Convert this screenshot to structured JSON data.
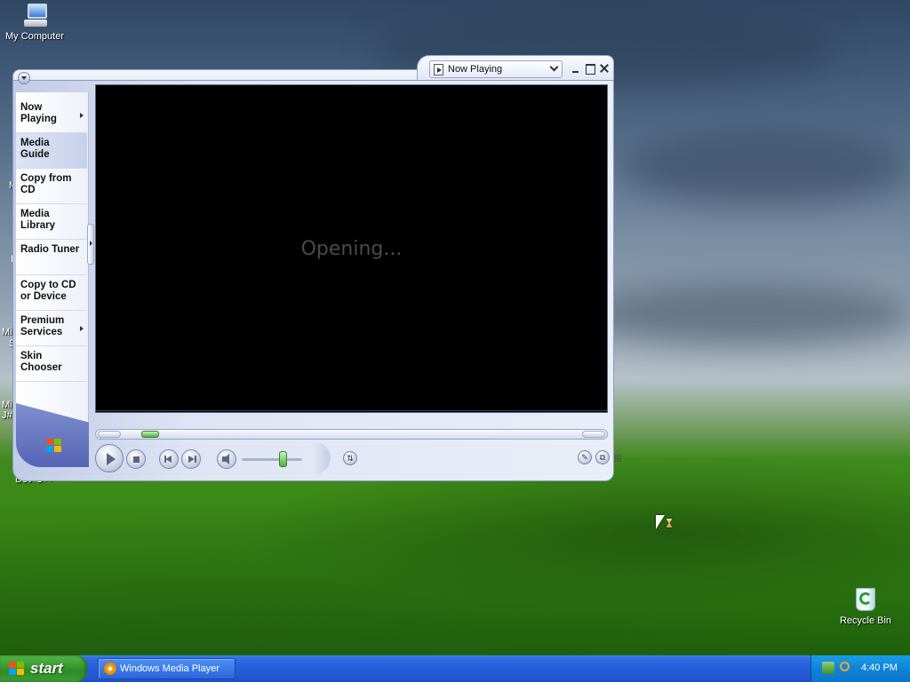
{
  "desktop": {
    "icons": {
      "my_computer": "My Computer",
      "dev_cpp": "Dev-C++",
      "recycle_bin": "Recycle Bin"
    },
    "partial_labels": [
      "M",
      "I",
      "Mic",
      "S",
      "Mic",
      "J#"
    ]
  },
  "wmp": {
    "title_select": "Now Playing",
    "taskpane": [
      {
        "label": "Now Playing",
        "has_arrow": true,
        "selected": false
      },
      {
        "label": "Media Guide",
        "has_arrow": false,
        "selected": true
      },
      {
        "label": "Copy from CD",
        "has_arrow": false,
        "selected": false
      },
      {
        "label": "Media Library",
        "has_arrow": false,
        "selected": false
      },
      {
        "label": "Radio Tuner",
        "has_arrow": false,
        "selected": false
      },
      {
        "label": "Copy to CD or Device",
        "has_arrow": false,
        "selected": false
      },
      {
        "label": "Premium Services",
        "has_arrow": true,
        "selected": false
      },
      {
        "label": "Skin Chooser",
        "has_arrow": false,
        "selected": false
      }
    ],
    "status_text": "Opening...",
    "volume_level": 0.62,
    "seek_position": 0.04
  },
  "taskbar": {
    "start_label": "start",
    "task_buttons": [
      "Windows Media Player"
    ],
    "clock": "4:40 PM"
  },
  "colors": {
    "taskbar_blue": "#245ed8",
    "start_green": "#3a9a2f",
    "tray_blue": "#0f84d8",
    "video_bg": "#000000"
  }
}
